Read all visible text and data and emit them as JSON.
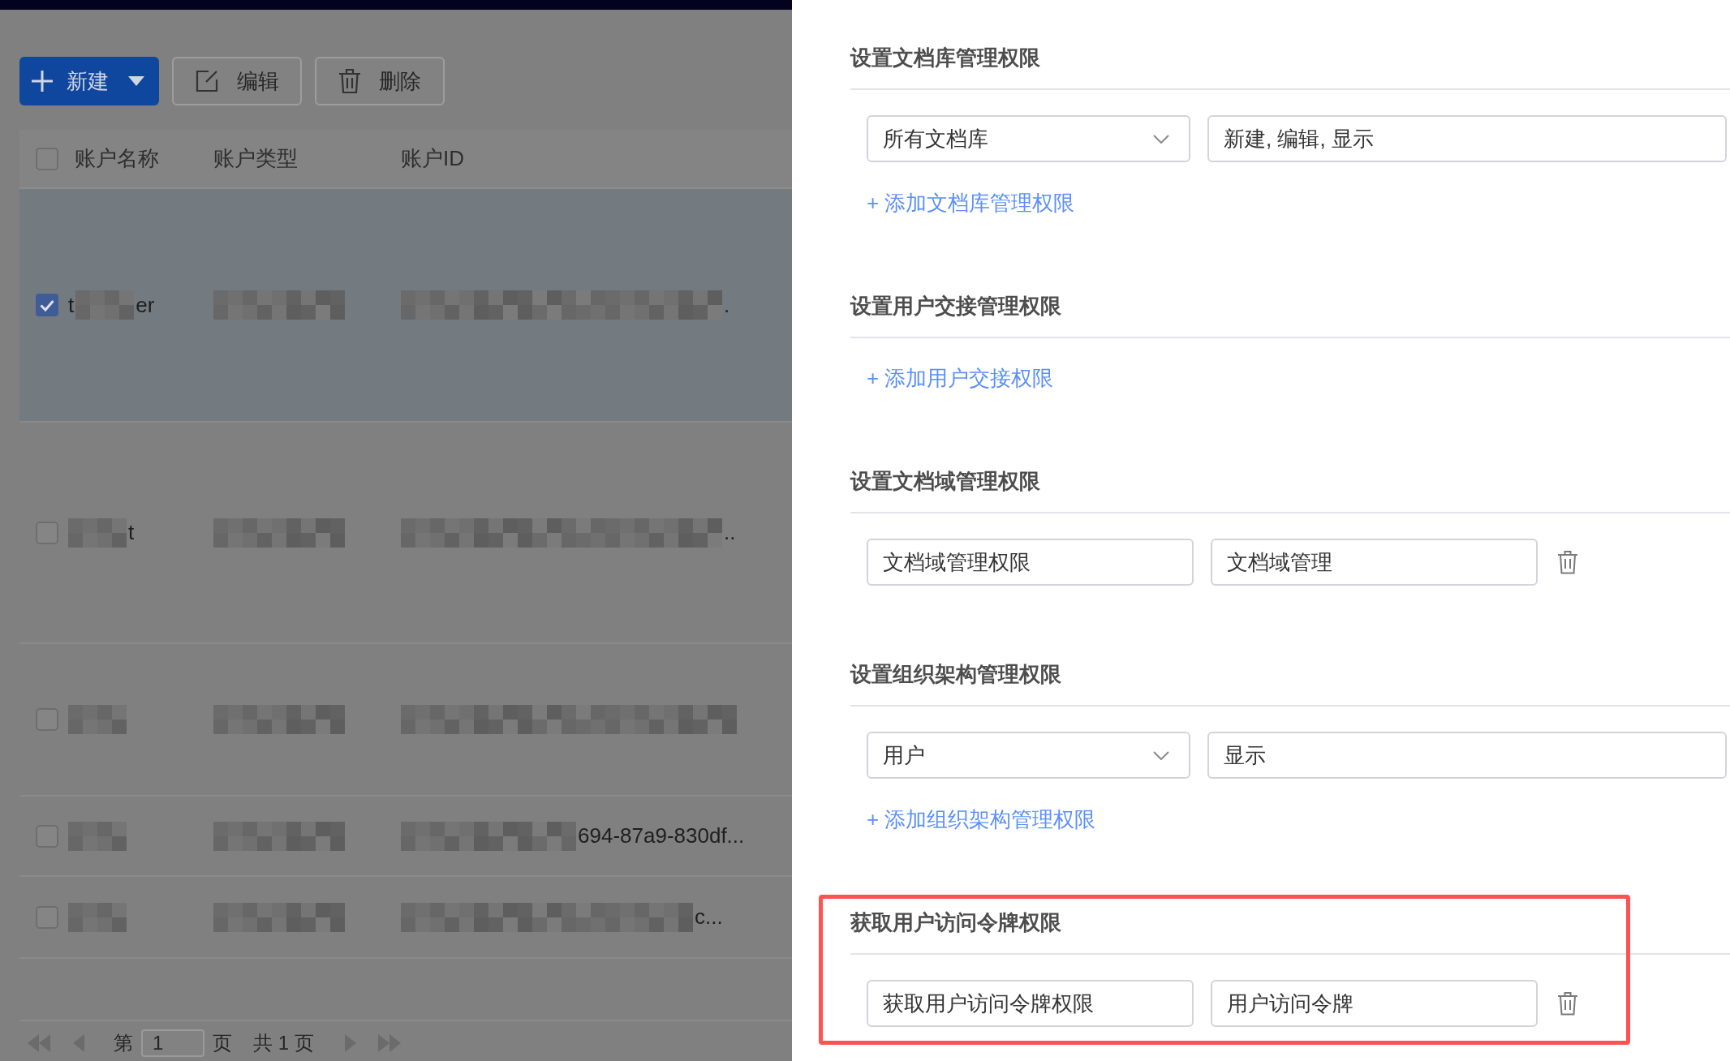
{
  "toolbar": [
    {
      "label": "新建",
      "kind": "primary"
    },
    {
      "label": "编辑",
      "kind": "default"
    },
    {
      "label": "删除",
      "kind": "default"
    }
  ],
  "table": {
    "select_all": {
      "checked": false
    },
    "columns": [
      "账户名称",
      "账户类型",
      "账户ID"
    ],
    "rows": [
      {
        "selected": true,
        "cells": [
          {
            "prefix": "t",
            "redacted": true,
            "suffix": "er"
          },
          {
            "redacted": true
          },
          {
            "redacted": true,
            "suffix": "."
          }
        ]
      },
      {
        "selected": false,
        "cells": [
          {
            "redacted": true,
            "suffix": "t"
          },
          {
            "redacted": true
          },
          {
            "redacted": true,
            "suffix": ".."
          }
        ]
      },
      {
        "selected": false,
        "cells": [
          {
            "redacted": true
          },
          {
            "redacted": true
          },
          {
            "redacted": true
          }
        ]
      },
      {
        "selected": false,
        "cells": [
          {
            "redacted": true
          },
          {
            "redacted": true
          },
          {
            "redacted": true,
            "suffix": "694-87a9-830df..."
          }
        ]
      },
      {
        "selected": false,
        "cells": [
          {
            "redacted": true
          },
          {
            "redacted": true
          },
          {
            "redacted": true,
            "suffix": "c..."
          }
        ]
      }
    ]
  },
  "pagination": {
    "before": "第",
    "page": "1",
    "after": "页",
    "total": "共 1 页"
  },
  "drawer": {
    "sections": [
      {
        "title": "设置文档库管理权限",
        "highlighted": false,
        "rows": [
          {
            "kind": "select",
            "target": "所有文档库",
            "permissions": "新建, 编辑, 显示",
            "deletable": false
          }
        ],
        "add_link": "+ 添加文档库管理权限"
      },
      {
        "title": "设置用户交接管理权限",
        "highlighted": false,
        "add_link": "+ 添加用户交接权限"
      },
      {
        "title": "设置文档域管理权限",
        "highlighted": false,
        "rows": [
          {
            "kind": "input",
            "target": "文档域管理权限",
            "permissions": "文档域管理",
            "deletable": true
          }
        ]
      },
      {
        "title": "设置组织架构管理权限",
        "highlighted": false,
        "rows": [
          {
            "kind": "select",
            "target": "用户",
            "permissions": "显示",
            "deletable": false
          }
        ],
        "add_link": "+ 添加组织架构管理权限"
      },
      {
        "title": "获取用户访问令牌权限",
        "highlighted": true,
        "rows": [
          {
            "kind": "input",
            "target": "获取用户访问令牌权限",
            "permissions": "用户访问令牌",
            "deletable": true
          }
        ]
      }
    ]
  }
}
